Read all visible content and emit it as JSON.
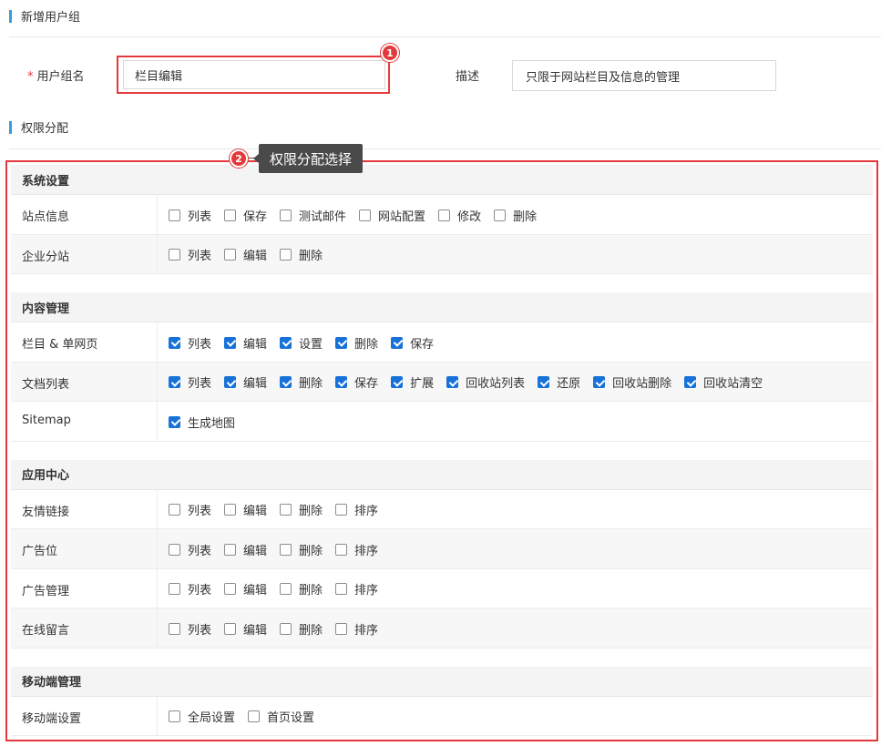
{
  "page": {
    "title": "新增用户组",
    "perm_title": "权限分配"
  },
  "form": {
    "name_label": "用户组名",
    "name_required_mark": "*",
    "name_value": "栏目编辑",
    "desc_label": "描述",
    "desc_value": "只限于网站栏目及信息的管理"
  },
  "annotations": {
    "marker1": "1",
    "marker2": "2",
    "tooltip": "权限分配选择",
    "accent_color": "#e4393c"
  },
  "groups": [
    {
      "title": "系统设置",
      "rows": [
        {
          "name": "站点信息",
          "options": [
            {
              "label": "列表",
              "checked": false
            },
            {
              "label": "保存",
              "checked": false
            },
            {
              "label": "测试邮件",
              "checked": false
            },
            {
              "label": "网站配置",
              "checked": false
            },
            {
              "label": "修改",
              "checked": false
            },
            {
              "label": "删除",
              "checked": false
            }
          ]
        },
        {
          "name": "企业分站",
          "options": [
            {
              "label": "列表",
              "checked": false
            },
            {
              "label": "编辑",
              "checked": false
            },
            {
              "label": "删除",
              "checked": false
            }
          ]
        }
      ]
    },
    {
      "title": "内容管理",
      "rows": [
        {
          "name": "栏目 & 单网页",
          "options": [
            {
              "label": "列表",
              "checked": true
            },
            {
              "label": "编辑",
              "checked": true
            },
            {
              "label": "设置",
              "checked": true
            },
            {
              "label": "删除",
              "checked": true
            },
            {
              "label": "保存",
              "checked": true
            }
          ]
        },
        {
          "name": "文档列表",
          "options": [
            {
              "label": "列表",
              "checked": true
            },
            {
              "label": "编辑",
              "checked": true
            },
            {
              "label": "删除",
              "checked": true
            },
            {
              "label": "保存",
              "checked": true
            },
            {
              "label": "扩展",
              "checked": true
            },
            {
              "label": "回收站列表",
              "checked": true
            },
            {
              "label": "还原",
              "checked": true
            },
            {
              "label": "回收站删除",
              "checked": true
            },
            {
              "label": "回收站清空",
              "checked": true
            }
          ]
        },
        {
          "name": "Sitemap",
          "options": [
            {
              "label": "生成地图",
              "checked": true
            }
          ]
        }
      ]
    },
    {
      "title": "应用中心",
      "rows": [
        {
          "name": "友情链接",
          "options": [
            {
              "label": "列表",
              "checked": false
            },
            {
              "label": "编辑",
              "checked": false
            },
            {
              "label": "删除",
              "checked": false
            },
            {
              "label": "排序",
              "checked": false
            }
          ]
        },
        {
          "name": "广告位",
          "options": [
            {
              "label": "列表",
              "checked": false
            },
            {
              "label": "编辑",
              "checked": false
            },
            {
              "label": "删除",
              "checked": false
            },
            {
              "label": "排序",
              "checked": false
            }
          ]
        },
        {
          "name": "广告管理",
          "options": [
            {
              "label": "列表",
              "checked": false
            },
            {
              "label": "编辑",
              "checked": false
            },
            {
              "label": "删除",
              "checked": false
            },
            {
              "label": "排序",
              "checked": false
            }
          ]
        },
        {
          "name": "在线留言",
          "options": [
            {
              "label": "列表",
              "checked": false
            },
            {
              "label": "编辑",
              "checked": false
            },
            {
              "label": "删除",
              "checked": false
            },
            {
              "label": "排序",
              "checked": false
            }
          ]
        }
      ]
    },
    {
      "title": "移动端管理",
      "rows": [
        {
          "name": "移动端设置",
          "options": [
            {
              "label": "全局设置",
              "checked": false
            },
            {
              "label": "首页设置",
              "checked": false
            }
          ]
        }
      ]
    }
  ]
}
